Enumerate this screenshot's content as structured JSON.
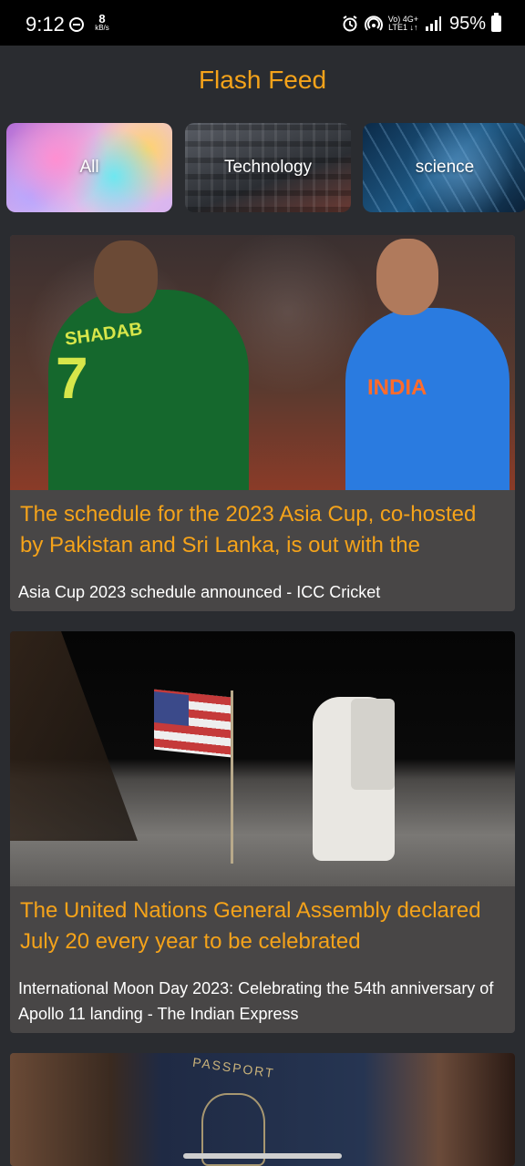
{
  "status_bar": {
    "time": "9:12",
    "speed_value": "8",
    "speed_unit": "kB/s",
    "network_label_top": "Vo) 4G+",
    "network_label_bottom": "LTE1 ↓↑",
    "battery": "95%"
  },
  "header": {
    "title": "Flash Feed",
    "accent_color": "#f5a31a"
  },
  "categories": [
    {
      "label": "All"
    },
    {
      "label": "Technology"
    },
    {
      "label": "science"
    }
  ],
  "articles": [
    {
      "headline": "The schedule for the 2023 Asia Cup, co-hosted by Pakistan and Sri Lanka, is out with the",
      "source": "Asia Cup 2023 schedule announced - ICC Cricket",
      "image": {
        "jersey_left": "SHADAB",
        "jersey_number": "7",
        "jersey_right": "INDIA"
      }
    },
    {
      "headline": "The United Nations General Assembly declared July 20 every year to be celebrated",
      "source": "International Moon Day 2023: Celebrating the 54th anniversary of Apollo 11 landing - The Indian Express"
    },
    {
      "image": {
        "cover_text": "PASSPORT"
      }
    }
  ]
}
